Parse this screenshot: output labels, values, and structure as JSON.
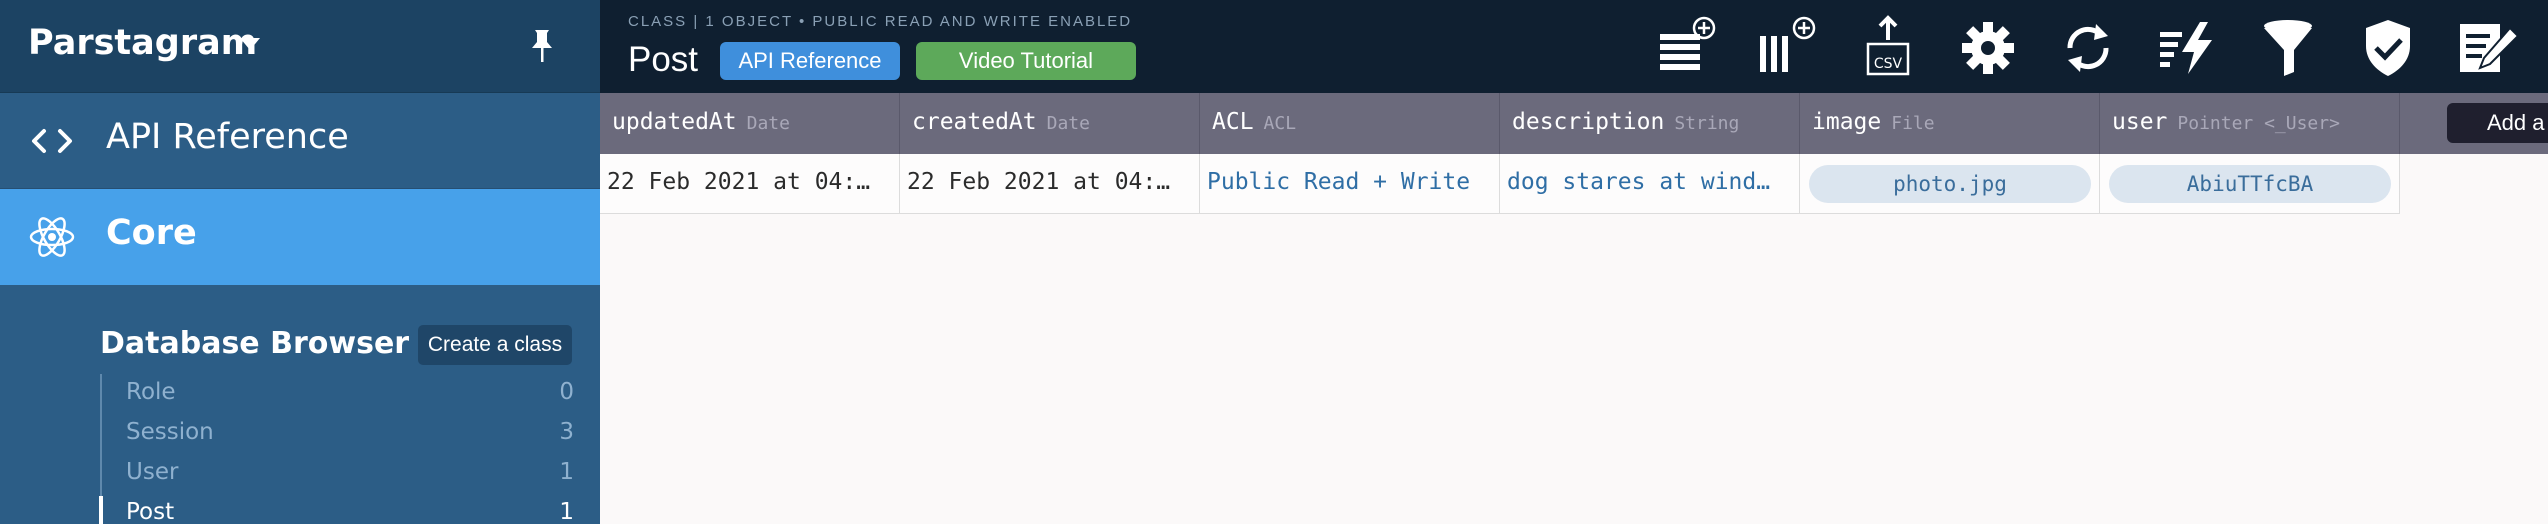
{
  "app": {
    "name": "Parstagram"
  },
  "sidebar": {
    "nav": [
      {
        "label": "API Reference",
        "icon": "code-brackets-icon"
      },
      {
        "label": "Core",
        "icon": "atom-icon",
        "active": true
      }
    ],
    "section_title": "Database Browser",
    "create_class_label": "Create a class",
    "classes": [
      {
        "name": "Role",
        "count": "0"
      },
      {
        "name": "Session",
        "count": "3"
      },
      {
        "name": "User",
        "count": "1"
      },
      {
        "name": "Post",
        "count": "1",
        "active": true
      }
    ]
  },
  "toolbar": {
    "subtitle": "CLASS | 1 OBJECT • PUBLIC READ AND WRITE ENABLED",
    "class_name": "Post",
    "api_reference_label": "API Reference",
    "video_tutorial_label": "Video Tutorial",
    "csv_label": "CSV",
    "tools": [
      "add-row-icon",
      "add-column-icon",
      "export-csv-icon",
      "settings-gear-icon",
      "refresh-icon",
      "trigger-icon",
      "filter-icon",
      "security-shield-icon",
      "edit-icon"
    ]
  },
  "table": {
    "columns": [
      {
        "name": "updatedAt",
        "type": "Date"
      },
      {
        "name": "createdAt",
        "type": "Date"
      },
      {
        "name": "ACL",
        "type": "ACL"
      },
      {
        "name": "description",
        "type": "String"
      },
      {
        "name": "image",
        "type": "File"
      },
      {
        "name": "user",
        "type": "Pointer <_User>"
      }
    ],
    "add_column_label": "Add a",
    "rows": [
      {
        "updatedAt": "22 Feb 2021 at 04:…",
        "createdAt": "22 Feb 2021 at 04:…",
        "ACL": "Public Read + Write",
        "description": "dog stares at wind…",
        "image": "photo.jpg",
        "user": "AbiuTTfcBA"
      }
    ]
  },
  "colors": {
    "sidebar_bg": "#2c5d86",
    "header_bg": "#1c4363",
    "active_nav": "#47a1ea",
    "toolbar_bg": "#0f1f30",
    "table_header": "#6b6a7c",
    "api_button": "#3f8fdc",
    "video_button": "#5da95a"
  }
}
